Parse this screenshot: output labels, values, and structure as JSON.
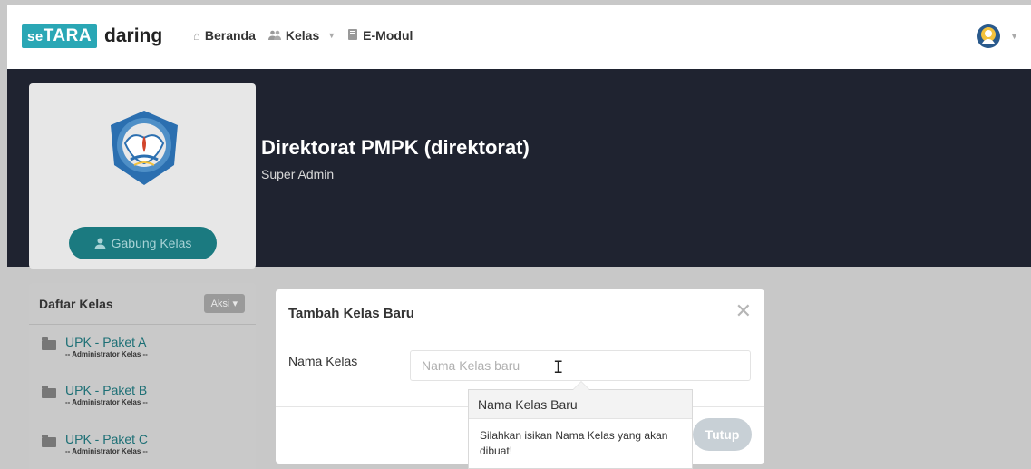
{
  "navbar": {
    "brand_prefix": "se",
    "brand_highlight": "TARA",
    "brand_suffix": "daring",
    "links": [
      {
        "label": "Beranda",
        "icon": "home-icon"
      },
      {
        "label": "Kelas",
        "icon": "users-icon",
        "has_dropdown": true
      },
      {
        "label": "E-Modul",
        "icon": "book-icon"
      }
    ],
    "user_icon": "avatar-icon"
  },
  "profile": {
    "name": "Direktorat PMPK (direktorat)",
    "role": "Super Admin",
    "logo": "tut-wuri-handayani-emblem",
    "join_button": "Gabung Kelas"
  },
  "sidebar": {
    "title": "Daftar Kelas",
    "action_button": "Aksi",
    "classes": [
      {
        "name": "UPK - Paket A",
        "role": "-- Administrator Kelas --"
      },
      {
        "name": "UPK - Paket B",
        "role": "-- Administrator Kelas --"
      },
      {
        "name": "UPK - Paket C",
        "role": "-- Administrator Kelas --"
      }
    ]
  },
  "modal": {
    "title": "Tambah Kelas Baru",
    "close_symbol": "✕",
    "field_label": "Nama Kelas",
    "field_placeholder": "Nama Kelas baru",
    "field_value": "",
    "close_button": "Tutup"
  },
  "tooltip": {
    "title": "Nama Kelas Baru",
    "text": "Silahkan isikan Nama Kelas yang akan dibuat!"
  },
  "colors": {
    "brand": "#2aa7b5",
    "header_bg": "#1f2330",
    "link": "#1c6f75"
  }
}
